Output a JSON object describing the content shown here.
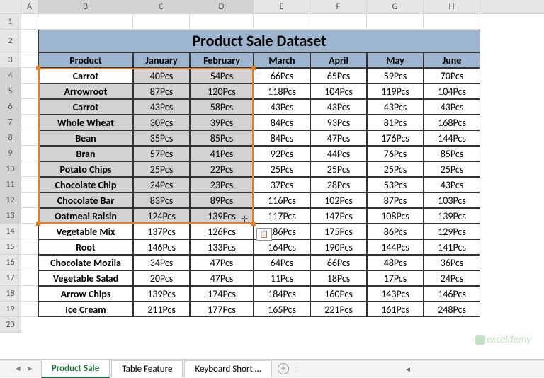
{
  "columns": [
    "A",
    "B",
    "C",
    "D",
    "E",
    "F",
    "G",
    "H"
  ],
  "rows": [
    "1",
    "2",
    "3",
    "4",
    "5",
    "6",
    "7",
    "8",
    "9",
    "10",
    "11",
    "12",
    "13",
    "14",
    "15",
    "16",
    "17",
    "18",
    "19",
    "20"
  ],
  "title": "Product Sale Dataset",
  "headers": [
    "Product",
    "January",
    "February",
    "March",
    "April",
    "May",
    "June"
  ],
  "data": [
    [
      "Carrot",
      "40Pcs",
      "54Pcs",
      "66Pcs",
      "65Pcs",
      "59Pcs",
      "70Pcs"
    ],
    [
      "Arrowroot",
      "87Pcs",
      "120Pcs",
      "118Pcs",
      "104Pcs",
      "119Pcs",
      "104Pcs"
    ],
    [
      "Carrot",
      "43Pcs",
      "58Pcs",
      "43Pcs",
      "43Pcs",
      "43Pcs",
      "43Pcs"
    ],
    [
      "Whole Wheat",
      "30Pcs",
      "39Pcs",
      "84Pcs",
      "93Pcs",
      "81Pcs",
      "168Pcs"
    ],
    [
      "Bean",
      "35Pcs",
      "85Pcs",
      "84Pcs",
      "47Pcs",
      "176Pcs",
      "144Pcs"
    ],
    [
      "Bran",
      "57Pcs",
      "41Pcs",
      "92Pcs",
      "44Pcs",
      "76Pcs",
      "85Pcs"
    ],
    [
      "Potato Chips",
      "25Pcs",
      "22Pcs",
      "25Pcs",
      "25Pcs",
      "25Pcs",
      "25Pcs"
    ],
    [
      "Chocolate Chip",
      "24Pcs",
      "23Pcs",
      "37Pcs",
      "28Pcs",
      "53Pcs",
      "43Pcs"
    ],
    [
      "Chocolate Bar",
      "83Pcs",
      "89Pcs",
      "116Pcs",
      "102Pcs",
      "87Pcs",
      "103Pcs"
    ],
    [
      "Oatmeal Raisin",
      "124Pcs",
      "139Pcs",
      "117Pcs",
      "147Pcs",
      "108Pcs",
      "139Pcs"
    ],
    [
      "Vegetable Mix",
      "137Pcs",
      "126Pcs",
      "186Pcs",
      "175Pcs",
      "86Pcs",
      "129Pcs"
    ],
    [
      "Root",
      "146Pcs",
      "133Pcs",
      "164Pcs",
      "190Pcs",
      "144Pcs",
      "141Pcs"
    ],
    [
      "Chocolate Mozila",
      "34Pcs",
      "47Pcs",
      "64Pcs",
      "66Pcs",
      "48Pcs",
      "36Pcs"
    ],
    [
      "Vegetable Salad",
      "20Pcs",
      "47Pcs",
      "11Pcs",
      "18Pcs",
      "17Pcs",
      "24Pcs"
    ],
    [
      "Arrow Chips",
      "139Pcs",
      "174Pcs",
      "184Pcs",
      "160Pcs",
      "143Pcs",
      "146Pcs"
    ],
    [
      "Ice Cream",
      "211Pcs",
      "177Pcs",
      "165Pcs",
      "221Pcs",
      "161Pcs",
      "248Pcs"
    ]
  ],
  "tabs": [
    "Product Sale",
    "Table Feature",
    "Keyboard Short …"
  ],
  "watermark": "exceldemy",
  "paste_icon": "📋"
}
